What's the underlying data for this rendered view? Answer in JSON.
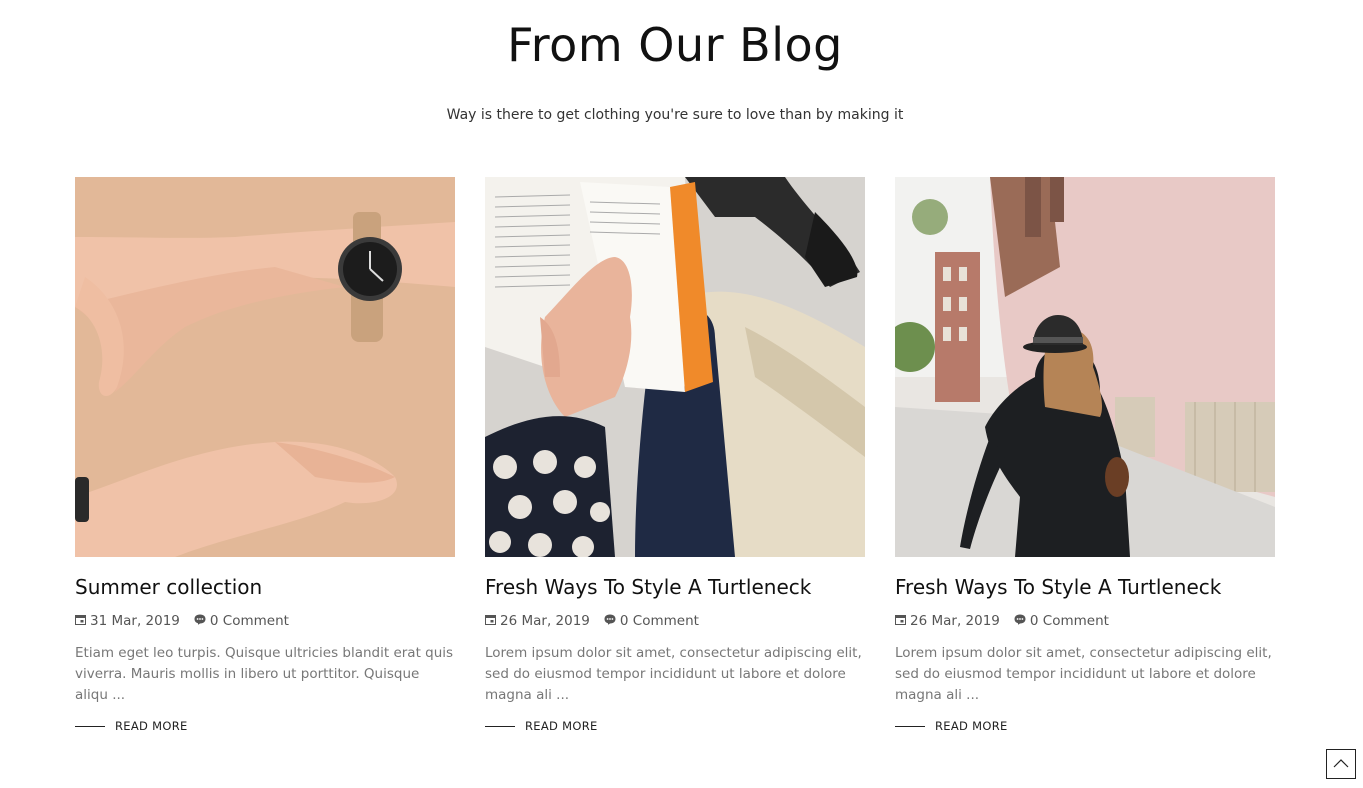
{
  "section": {
    "title": "From Our Blog",
    "subtitle": "Way is there to get clothing you're sure to love than by making it"
  },
  "posts": [
    {
      "title": "Summer collection",
      "date": "31 Mar, 2019",
      "comments": "0 Comment",
      "excerpt": "Etiam eget leo turpis. Quisque ultricies blandit erat quis viverra. Mauris mollis in libero ut porttitor. Quisque aliqu ...",
      "read_more": "READ MORE",
      "image": "hands-with-watch-photo"
    },
    {
      "title": "Fresh Ways To Style A Turtleneck",
      "date": "26 Mar, 2019",
      "comments": "0 Comment",
      "excerpt": "Lorem ipsum dolor sit amet, consectetur adipiscing elit, sed do eiusmod tempor incididunt ut labore et dolore magna ali ...",
      "read_more": "READ MORE",
      "image": "reading-book-photo"
    },
    {
      "title": "Fresh Ways To Style A Turtleneck",
      "date": "26 Mar, 2019",
      "comments": "0 Comment",
      "excerpt": "Lorem ipsum dolor sit amet, consectetur adipiscing elit, sed do eiusmod tempor incididunt ut labore et dolore magna ali ...",
      "read_more": "READ MORE",
      "image": "woman-walking-street-photo"
    }
  ],
  "icons": {
    "date": "calendar-icon",
    "comments": "comment-icon",
    "scroll_top": "chevron-up-icon"
  }
}
